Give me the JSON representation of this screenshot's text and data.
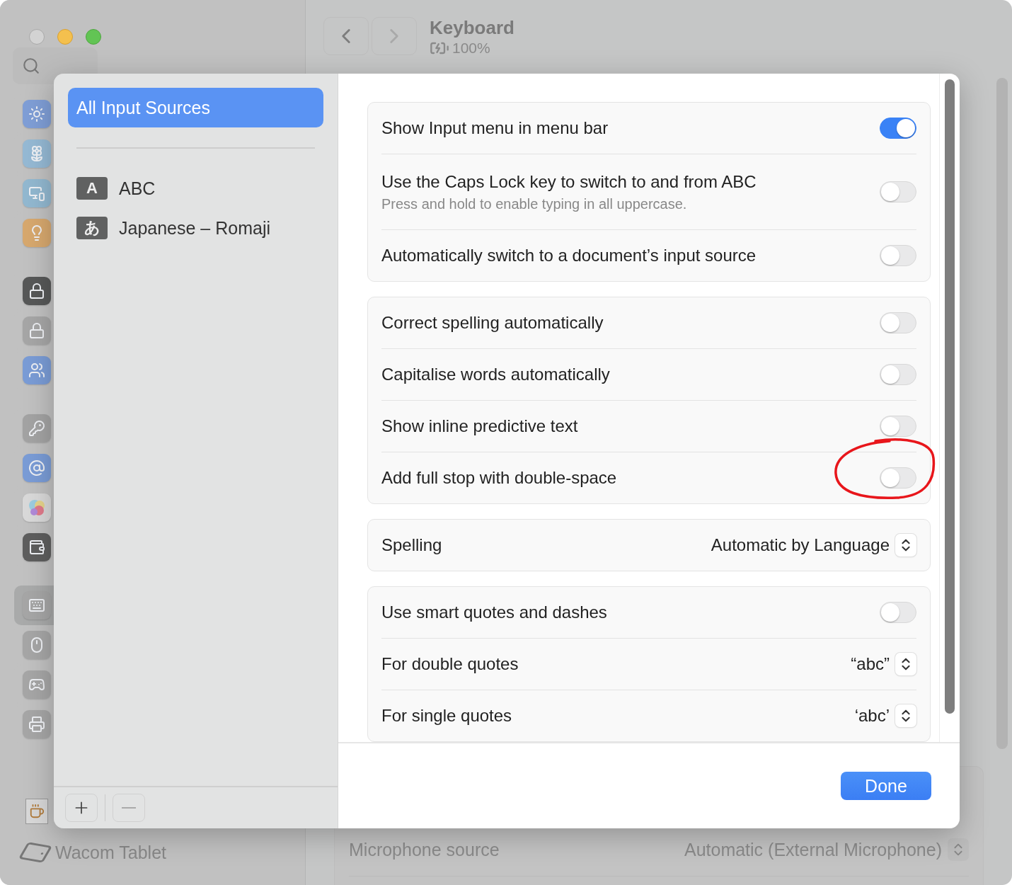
{
  "window": {
    "controls": [
      {
        "kind": "close"
      },
      {
        "kind": "minimize"
      },
      {
        "kind": "zoom"
      }
    ]
  },
  "toolbar": {
    "title": "Keyboard",
    "battery": "100%"
  },
  "sidebar": {
    "groups": [
      [
        {
          "kind": "sun",
          "selected": false
        },
        {
          "kind": "flower",
          "selected": false
        },
        {
          "kind": "wallpaper",
          "selected": false
        },
        {
          "kind": "bulb",
          "selected": false
        }
      ],
      [
        {
          "kind": "lockscreen",
          "selected": false
        },
        {
          "kind": "lock",
          "selected": false
        },
        {
          "kind": "users",
          "selected": false
        }
      ],
      [
        {
          "kind": "key",
          "selected": false
        },
        {
          "kind": "at",
          "selected": false
        },
        {
          "kind": "bubbles",
          "selected": false
        },
        {
          "kind": "wallet",
          "selected": false
        }
      ],
      [
        {
          "kind": "keyboard",
          "selected": true
        },
        {
          "kind": "mouse",
          "selected": false
        },
        {
          "kind": "gamepad",
          "selected": false
        },
        {
          "kind": "printer",
          "selected": false
        }
      ]
    ],
    "footer_item": "Wacom Tablet"
  },
  "background_rows": [
    {
      "label": "Microphone source",
      "value": "Automatic (External Microphone)"
    }
  ],
  "sheet": {
    "sources_header": {
      "label": "All Input Sources",
      "selected": true
    },
    "sources": [
      {
        "badge": "A",
        "label": "ABC",
        "selected": false
      },
      {
        "badge": "あ",
        "label": "Japanese – Romaji",
        "selected": false
      }
    ],
    "list_buttons": [
      {
        "kind": "add",
        "disabled": false
      },
      {
        "kind": "remove",
        "disabled": true
      }
    ],
    "groups": [
      {
        "rows": [
          {
            "kind": "toggle",
            "label": "Show Input menu in menu bar",
            "on": true,
            "annotated": false
          },
          {
            "kind": "toggle",
            "label": "Use the Caps Lock key to switch to and from ABC",
            "sublabel": "Press and hold to enable typing in all uppercase.",
            "on": false,
            "annotated": false
          },
          {
            "kind": "toggle",
            "label": "Automatically switch to a document’s input source",
            "on": false,
            "annotated": false
          }
        ]
      },
      {
        "rows": [
          {
            "kind": "toggle",
            "label": "Correct spelling automatically",
            "on": false,
            "annotated": false
          },
          {
            "kind": "toggle",
            "label": "Capitalise words automatically",
            "on": false,
            "annotated": false
          },
          {
            "kind": "toggle",
            "label": "Show inline predictive text",
            "on": false,
            "annotated": false
          },
          {
            "kind": "toggle",
            "label": "Add full stop with double-space",
            "on": false,
            "annotated": true
          }
        ]
      },
      {
        "rows": [
          {
            "kind": "select",
            "label": "Spelling",
            "value": "Automatic by Language"
          }
        ]
      },
      {
        "rows": [
          {
            "kind": "toggle",
            "label": "Use smart quotes and dashes",
            "on": false,
            "annotated": false
          },
          {
            "kind": "select",
            "label": "For double quotes",
            "value": "“abc”"
          },
          {
            "kind": "select",
            "label": "For single quotes",
            "value": "‘abc’"
          }
        ]
      }
    ],
    "done": "Done"
  }
}
